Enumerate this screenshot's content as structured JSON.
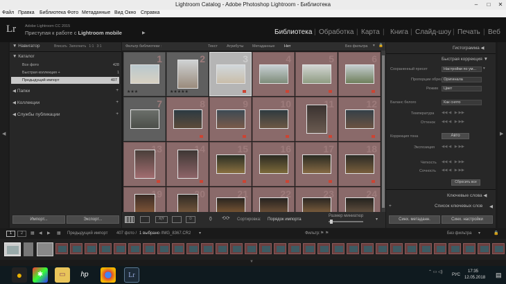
{
  "window": {
    "title": "Lightroom Catalog - Adobe Photoshop Lightroom - Библиотека"
  },
  "menu": [
    "Файл",
    "Правка",
    "Библиотека",
    "Фото",
    "Метаданные",
    "Вид",
    "Окно",
    "Справка"
  ],
  "identity": {
    "logo": "Lr",
    "version": "Adobe Lightroom CC 2015",
    "mobile_prefix": "Приступая к работе с",
    "mobile_bold": "Lightroom mobile"
  },
  "modules": [
    "Библиотека",
    "Обработка",
    "Карта",
    "Книга",
    "Слайд-шоу",
    "Печать",
    "Веб"
  ],
  "left_panel": {
    "navigator": {
      "title": "Навигатор",
      "zoom": [
        "Вписать",
        "Заполнить",
        "1:1",
        "3:1"
      ]
    },
    "catalog": {
      "title": "Каталог",
      "items": [
        {
          "label": "Все фото",
          "count": "428"
        },
        {
          "label": "Быстрая коллекция +",
          "count": "1"
        },
        {
          "label": "Предыдущий импорт",
          "count": "407"
        }
      ]
    },
    "sections": [
      "Папки",
      "Коллекции",
      "Службы публикации"
    ],
    "import_label": "Импорт...",
    "export_label": "Экспорт..."
  },
  "filter": {
    "label": "Фильтр библиотеки :",
    "tabs": [
      "Текст",
      "Атрибуты",
      "Метаданные",
      "Нет"
    ],
    "preset": "Без фильтра"
  },
  "grid": {
    "numbers": [
      "1",
      "2",
      "3",
      "4",
      "5",
      "6",
      "7",
      "8",
      "9",
      "10",
      "11",
      "12",
      "13",
      "14",
      "15",
      "16",
      "17",
      "18",
      "19",
      "20",
      "21",
      "22",
      "23",
      "24"
    ],
    "stars_small": "★★★",
    "stars_big": "★★★★★"
  },
  "toolbar": {
    "sort_label": "Сортировка:",
    "sort_value": "Порядок импорта",
    "size_label": "Размер миниатюр"
  },
  "right_panel": {
    "histogram": "Гистограмма",
    "quick_develop": "Быстрая коррекция",
    "saved_preset": {
      "label": "Сохраненный пресет",
      "value": "Настройки по ум..."
    },
    "crop": {
      "label": "Пропорции обрезки",
      "value": "Оригинала"
    },
    "mode": {
      "label": "Режим",
      "value": "Цвет"
    },
    "wb": {
      "label": "Баланс белого",
      "value": "Как снято"
    },
    "temp": "Температура",
    "tint": "Оттенок",
    "tone": {
      "label": "Коррекция тона",
      "auto": "Авто"
    },
    "exposure": "Экспозиция",
    "clarity": "Четкость",
    "vibrance": "Сочность",
    "reset": "Сбросить все",
    "keywording": "Ключевые слова",
    "keyword_list": "Список ключевых слов",
    "sync_meta": "Синх. метаданн.",
    "sync_settings": "Синх. настройки"
  },
  "filmstrip": {
    "pages": [
      "1",
      "2"
    ],
    "source": "Предыдущий импорт",
    "count": "407 фото /",
    "selected": "1 выбрано",
    "file": "/IMG_8367.CR2",
    "filter_label": "Фильтр:",
    "filter_value": "Без фильтра"
  },
  "taskbar": {
    "lang": "РУС",
    "time": "17:35",
    "date": "12.05.2018"
  }
}
